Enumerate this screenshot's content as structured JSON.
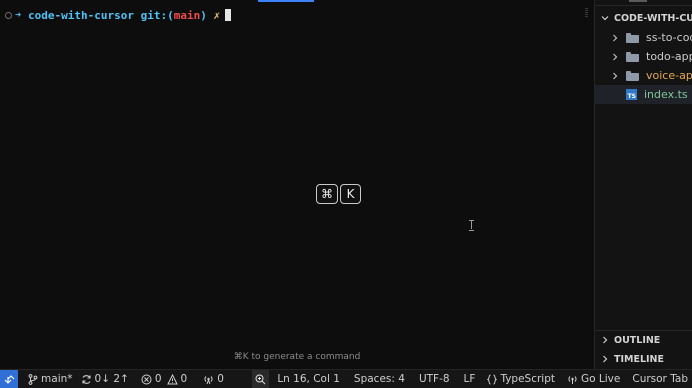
{
  "terminal": {
    "prompt": {
      "arrow": "➜",
      "directory": "code-with-cursor",
      "git_label": "git:(",
      "branch": "main",
      "git_close": ")",
      "dirty_marker": "✗"
    },
    "shortcut_keys": [
      "⌘",
      "K"
    ],
    "generate_hint": "⌘K to generate a command"
  },
  "explorer": {
    "root_label": "CODE-WITH-CURSOR",
    "items": [
      {
        "type": "folder",
        "label": "ss-to-code",
        "color": "#cccccc"
      },
      {
        "type": "folder",
        "label": "todo-app",
        "color": "#cccccc"
      },
      {
        "type": "folder",
        "label": "voice-app",
        "color": "#e2a852"
      },
      {
        "type": "file",
        "label": "index.ts",
        "icon": "TS",
        "color": "#7ec699"
      }
    ],
    "outline_label": "OUTLINE",
    "timeline_label": "TIMELINE"
  },
  "statusbar": {
    "branch": "main*",
    "sync": "0↓ 2↑",
    "errors": "0",
    "warnings": "0",
    "ports": "0",
    "position": "Ln 16, Col 1",
    "spaces": "Spaces: 4",
    "encoding": "UTF-8",
    "eol": "LF",
    "language": "TypeScript",
    "golive": "Go Live",
    "cursor_tab": "Cursor Tab"
  },
  "colors": {
    "accent": "#2f6fd6",
    "prompt_cyan": "#4fc3f7",
    "branch_red": "#f14c4c",
    "typescript_blue": "#3178c6"
  }
}
